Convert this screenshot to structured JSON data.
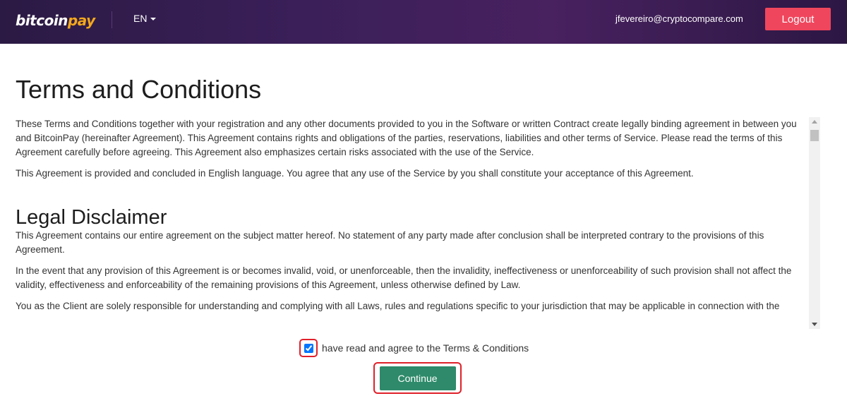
{
  "header": {
    "logo": {
      "part1": "bitcoin",
      "part2": "pay"
    },
    "language": "EN",
    "user_email": "jfevereiro@cryptocompare.com",
    "logout_label": "Logout"
  },
  "main": {
    "title": "Terms and Conditions",
    "paragraphs": [
      "These Terms and Conditions together with your registration and any other documents provided to you in the Software or written Contract create legally binding agreement in between you and BitcoinPay (hereinafter Agreement). This Agreement contains rights and obligations of the parties, reservations, liabilities and other terms of Service. Please read the terms of this Agreement carefully before agreeing. This Agreement also emphasizes certain risks associated with the use of the Service.",
      "This Agreement is provided and concluded in English language. You agree that any use of the Service by you shall constitute your acceptance of this Agreement."
    ],
    "section2": {
      "heading": "Legal Disclaimer",
      "paragraphs": [
        "This Agreement contains our entire agreement on the subject matter hereof. No statement of any party made after conclusion shall be interpreted contrary to the provisions of this Agreement.",
        "In the event that any provision of this Agreement is or becomes invalid, void, or unenforceable, then the invalidity, ineffectiveness or unenforceability of such provision shall not affect the validity, effectiveness and enforceability of the remaining provisions of this Agreement, unless otherwise defined by Law.",
        "You as the Client are solely responsible for understanding and complying with all Laws, rules and regulations specific to your jurisdiction that may be applicable in connection with the"
      ]
    }
  },
  "agreement": {
    "checked": true,
    "label": "have read and agree to the Terms & Conditions"
  },
  "continue_label": "Continue",
  "colors": {
    "header_bg": "#3a1f58",
    "logout_bg": "#f0465d",
    "continue_bg": "#2e8a6a",
    "highlight_border": "#e0202a",
    "logo_accent": "#f3a81c"
  }
}
